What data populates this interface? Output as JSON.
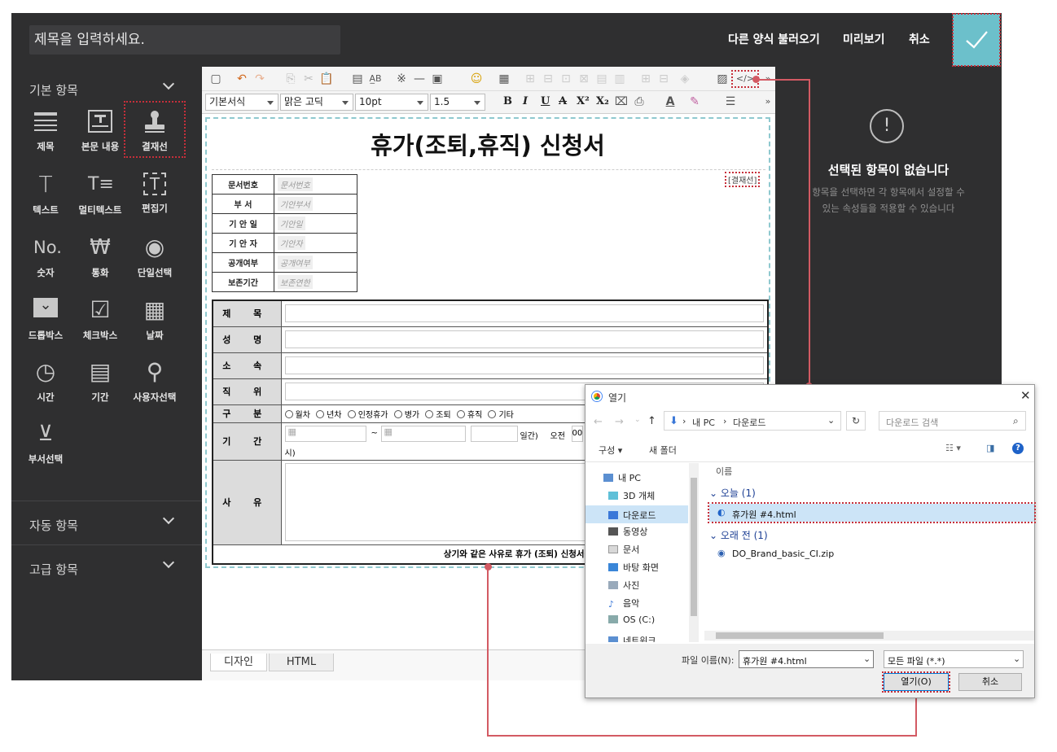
{
  "topbar": {
    "title_placeholder": "제목을 입력하세요.",
    "load_other_form": "다른 양식 불러오기",
    "preview": "미리보기",
    "cancel": "취소"
  },
  "sidebar": {
    "basic_title": "기본 항목",
    "auto_title": "자동 항목",
    "advanced_title": "고급 항목",
    "tools": [
      {
        "label": "제목",
        "icon": "title-lines-icon"
      },
      {
        "label": "본문 내용",
        "icon": "body-text-icon"
      },
      {
        "label": "결재선",
        "icon": "stamp-icon"
      },
      {
        "label": "텍스트",
        "icon": "text-icon",
        "glyph": "T"
      },
      {
        "label": "멀티텍스트",
        "icon": "multitext-icon",
        "glyph": "T≡"
      },
      {
        "label": "편집기",
        "icon": "editor-icon",
        "glyph": "T"
      },
      {
        "label": "숫자",
        "icon": "number-icon",
        "glyph": "No."
      },
      {
        "label": "통화",
        "icon": "currency-icon",
        "glyph": "₩"
      },
      {
        "label": "단일선택",
        "icon": "radio-icon",
        "glyph": "◉"
      },
      {
        "label": "드롭박스",
        "icon": "dropbox-icon",
        "glyph": "⌄"
      },
      {
        "label": "체크박스",
        "icon": "checkbox-icon",
        "glyph": "☑"
      },
      {
        "label": "날짜",
        "icon": "calendar-icon",
        "glyph": "▦"
      },
      {
        "label": "시간",
        "icon": "clock-icon",
        "glyph": "◷"
      },
      {
        "label": "기간",
        "icon": "period-icon",
        "glyph": "▤"
      },
      {
        "label": "사용자선택",
        "icon": "user-select-icon",
        "glyph": "⚲"
      },
      {
        "label": "부서선택",
        "icon": "dept-select-icon",
        "glyph": "⊻"
      }
    ]
  },
  "editor": {
    "toolbar": {
      "style": "기본서식",
      "font": "맑은 고딕",
      "size": "10pt",
      "line_height": "1.5",
      "bold": "B",
      "italic": "I",
      "underline": "U",
      "strike": "A",
      "superscript": "X²",
      "subscript": "X₂"
    },
    "doc_title": "휴가(조퇴,휴직) 신청서",
    "approval_tag": "[결재선]",
    "meta": [
      {
        "key": "문서번호",
        "ph": "문서번호"
      },
      {
        "key": "부 서",
        "ph": "기안부서"
      },
      {
        "key": "기 안 일",
        "ph": "기안일"
      },
      {
        "key": "기 안 자",
        "ph": "기안자"
      },
      {
        "key": "공개여부",
        "ph": "공개여부"
      },
      {
        "key": "보존기간",
        "ph": "보존연한"
      }
    ],
    "rows": {
      "subject": "제 목",
      "name": "성 명",
      "dept": "소 속",
      "position": "직 위",
      "category": "구 분",
      "period": "기 간",
      "reason": "사 유"
    },
    "category_options": [
      "월차",
      "년차",
      "인정휴가",
      "병가",
      "조퇴",
      "휴직",
      "기타"
    ],
    "period_tilde": "~",
    "period_days": "일간)",
    "period_am": "오전",
    "period_00": "00",
    "period_cont": "시)",
    "footer_note": "상기와 같은 사유로 휴가 (조퇴) 신청서를 제출합니다",
    "tabs": {
      "design": "디자인",
      "html": "HTML"
    }
  },
  "right_panel": {
    "icon_glyph": "!",
    "heading": "선택된 항목이 없습니다",
    "desc_line1": "항목을 선택하면 각 항목에서 설정할 수",
    "desc_line2": "있는 속성들을 적용할 수 있습니다"
  },
  "dialog": {
    "title": "열기",
    "close": "✕",
    "path": [
      "내 PC",
      "다운로드"
    ],
    "search_placeholder": "다운로드 검색",
    "organize": "구성 ▾",
    "new_folder": "새 폴더",
    "nav": [
      "내 PC",
      "3D 개체",
      "다운로드",
      "동영상",
      "문서",
      "바탕 화면",
      "사진",
      "음악",
      "OS (C:)",
      "네트워크"
    ],
    "column_name": "이름",
    "group_today": "오늘 (1)",
    "group_old": "오래 전 (1)",
    "file_today": "휴가원 #4.html",
    "file_old": "DO_Brand_basic_CI.zip",
    "filename_label": "파일 이름(N):",
    "filename_value": "휴가원 #4.html",
    "filetype": "모든 파일 (*.*)",
    "open_btn": "열기(O)",
    "cancel_btn": "취소"
  },
  "colors": {
    "dark_bg": "#2f2f30",
    "accent_teal": "#6cc0cb",
    "highlight_red": "#c62f3a",
    "leader": "#d35a63"
  }
}
